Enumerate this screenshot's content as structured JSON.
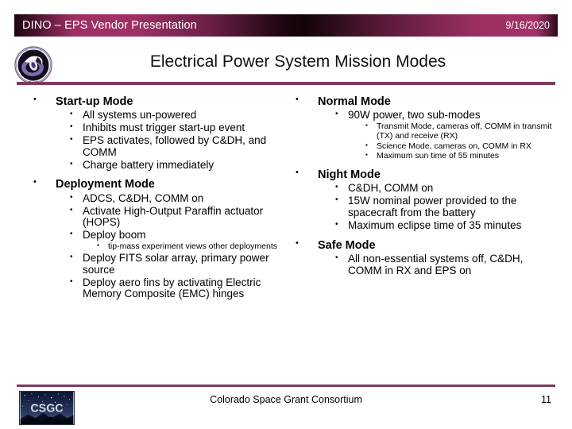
{
  "header": {
    "title": "DINO – EPS Vendor Presentation",
    "date": "9/16/2020"
  },
  "slide": {
    "title": "Electrical Power System Mission Modes"
  },
  "left_column": [
    {
      "heading": "Start-up Mode",
      "items": [
        {
          "text": "All systems un-powered",
          "level": 2
        },
        {
          "text": "Inhibits must trigger start-up event",
          "level": 2
        },
        {
          "text": "EPS activates, followed by C&DH, and COMM",
          "level": 2
        },
        {
          "text": "Charge battery immediately",
          "level": 2
        }
      ]
    },
    {
      "heading": "Deployment Mode",
      "items": [
        {
          "text": "ADCS, C&DH, COMM on",
          "level": 2
        },
        {
          "text": "Activate High-Output Paraffin actuator (HOPS)",
          "level": 2
        },
        {
          "text": "Deploy boom",
          "level": 2
        },
        {
          "text": "tip-mass experiment views other deployments",
          "level": 3
        },
        {
          "text": "Deploy FITS solar array, primary power source",
          "level": 2
        },
        {
          "text": "Deploy aero fins by activating Electric Memory Composite (EMC) hinges",
          "level": 2
        }
      ]
    }
  ],
  "right_column": [
    {
      "heading": "Normal Mode",
      "items": [
        {
          "text": "90W power, two sub-modes",
          "level": 2
        },
        {
          "text": "Transmit Mode, cameras off, COMM in transmit (TX) and receive (RX)",
          "level": 3
        },
        {
          "text": "Science Mode, cameras on, COMM in RX",
          "level": 3
        },
        {
          "text": "Maximum sun time of 55 minutes",
          "level": 3
        }
      ]
    },
    {
      "heading": "Night Mode",
      "items": [
        {
          "text": "C&DH, COMM on",
          "level": 2
        },
        {
          "text": "15W nominal power provided to the spacecraft from the battery",
          "level": 2
        },
        {
          "text": "Maximum eclipse time of 35 minutes",
          "level": 2
        }
      ]
    },
    {
      "heading": "Safe Mode",
      "items": [
        {
          "text": "All non-essential systems off, C&DH, COMM in RX and EPS on",
          "level": 2
        }
      ]
    }
  ],
  "footer": {
    "organization": "Colorado Space Grant Consortium",
    "page_number": "11",
    "logo_text": "CSGC"
  },
  "colors": {
    "accent_rule": "#7d3a61",
    "header_magenta": "#a03166",
    "header_dark": "#1a0510",
    "logo_sky": "#1b2a4d"
  },
  "icons": {
    "patch": "dino-mission-patch-icon",
    "csgc": "csgc-logo-icon"
  }
}
